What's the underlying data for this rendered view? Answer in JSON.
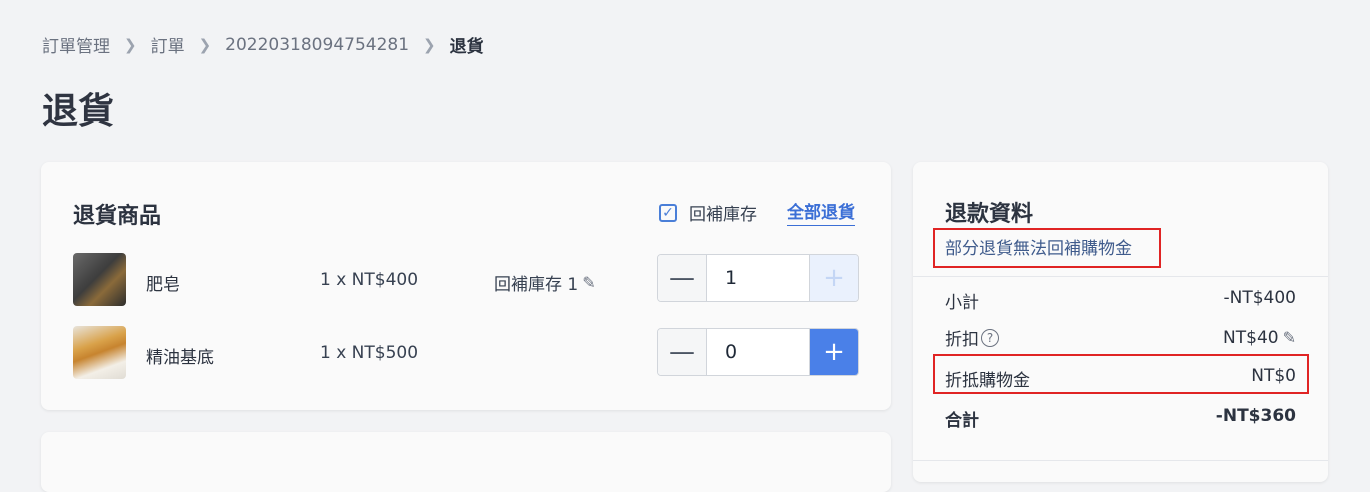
{
  "breadcrumb": [
    "訂單管理",
    "訂單",
    "20220318094754281",
    "退貨"
  ],
  "page_title": "退貨",
  "returns_card": {
    "title": "退貨商品",
    "restock_label": "回補庫存",
    "restock_checked": true,
    "return_all_label": "全部退貨",
    "items": [
      {
        "name": "肥皂",
        "qty_price": "1 x NT$400",
        "restock": "回補庫存 1",
        "value": "1",
        "plus_enabled": false
      },
      {
        "name": "精油基底",
        "qty_price": "1 x NT$500",
        "value": "0",
        "plus_enabled": true
      }
    ]
  },
  "refund_card": {
    "title": "退款資料",
    "note": "部分退貨無法回補購物金",
    "subtotal_label": "小計",
    "subtotal_value": "-NT$400",
    "discount_label": "折扣",
    "discount_value": "NT$40",
    "credit_label": "折抵購物金",
    "credit_value": "NT$0",
    "total_label": "合計",
    "total_value": "-NT$360"
  },
  "colors": {
    "accent": "#4a80e8",
    "highlight": "#e02424",
    "link": "#3b6fd6"
  },
  "icons": [
    "chevron-right-icon",
    "check-icon",
    "pencil-icon",
    "minus-icon",
    "plus-icon",
    "help-icon"
  ]
}
